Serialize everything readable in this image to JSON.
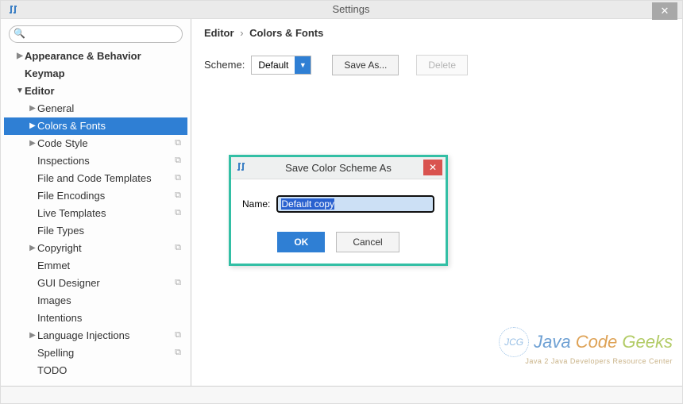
{
  "window": {
    "title": "Settings"
  },
  "search": {
    "placeholder": ""
  },
  "tree": {
    "items": [
      {
        "label": "Appearance & Behavior",
        "level": 0,
        "arrow": "▶",
        "bold": true,
        "copy": false
      },
      {
        "label": "Keymap",
        "level": 0,
        "arrow": "",
        "bold": true,
        "copy": false
      },
      {
        "label": "Editor",
        "level": 0,
        "arrow": "▼",
        "bold": true,
        "copy": false
      },
      {
        "label": "General",
        "level": 1,
        "arrow": "▶",
        "bold": false,
        "copy": false
      },
      {
        "label": "Colors & Fonts",
        "level": 1,
        "arrow": "▶",
        "bold": false,
        "copy": false,
        "selected": true
      },
      {
        "label": "Code Style",
        "level": 1,
        "arrow": "▶",
        "bold": false,
        "copy": true
      },
      {
        "label": "Inspections",
        "level": 1,
        "arrow": "",
        "bold": false,
        "copy": true
      },
      {
        "label": "File and Code Templates",
        "level": 1,
        "arrow": "",
        "bold": false,
        "copy": true
      },
      {
        "label": "File Encodings",
        "level": 1,
        "arrow": "",
        "bold": false,
        "copy": true
      },
      {
        "label": "Live Templates",
        "level": 1,
        "arrow": "",
        "bold": false,
        "copy": true
      },
      {
        "label": "File Types",
        "level": 1,
        "arrow": "",
        "bold": false,
        "copy": false
      },
      {
        "label": "Copyright",
        "level": 1,
        "arrow": "▶",
        "bold": false,
        "copy": true
      },
      {
        "label": "Emmet",
        "level": 1,
        "arrow": "",
        "bold": false,
        "copy": false
      },
      {
        "label": "GUI Designer",
        "level": 1,
        "arrow": "",
        "bold": false,
        "copy": true
      },
      {
        "label": "Images",
        "level": 1,
        "arrow": "",
        "bold": false,
        "copy": false
      },
      {
        "label": "Intentions",
        "level": 1,
        "arrow": "",
        "bold": false,
        "copy": false
      },
      {
        "label": "Language Injections",
        "level": 1,
        "arrow": "▶",
        "bold": false,
        "copy": true
      },
      {
        "label": "Spelling",
        "level": 1,
        "arrow": "",
        "bold": false,
        "copy": true
      },
      {
        "label": "TODO",
        "level": 1,
        "arrow": "",
        "bold": false,
        "copy": false
      }
    ]
  },
  "breadcrumb": {
    "part1": "Editor",
    "sep": "›",
    "part2": "Colors & Fonts"
  },
  "scheme": {
    "label": "Scheme:",
    "value": "Default",
    "saveAs": "Save As...",
    "delete": "Delete"
  },
  "dialog": {
    "title": "Save Color Scheme As",
    "nameLabel": "Name:",
    "nameValue": "Default copy",
    "ok": "OK",
    "cancel": "Cancel"
  },
  "watermark": {
    "j": "Java",
    "c": "Code",
    "g": "Geeks",
    "sub": "Java 2 Java Developers Resource Center",
    "circ": "JCG"
  }
}
